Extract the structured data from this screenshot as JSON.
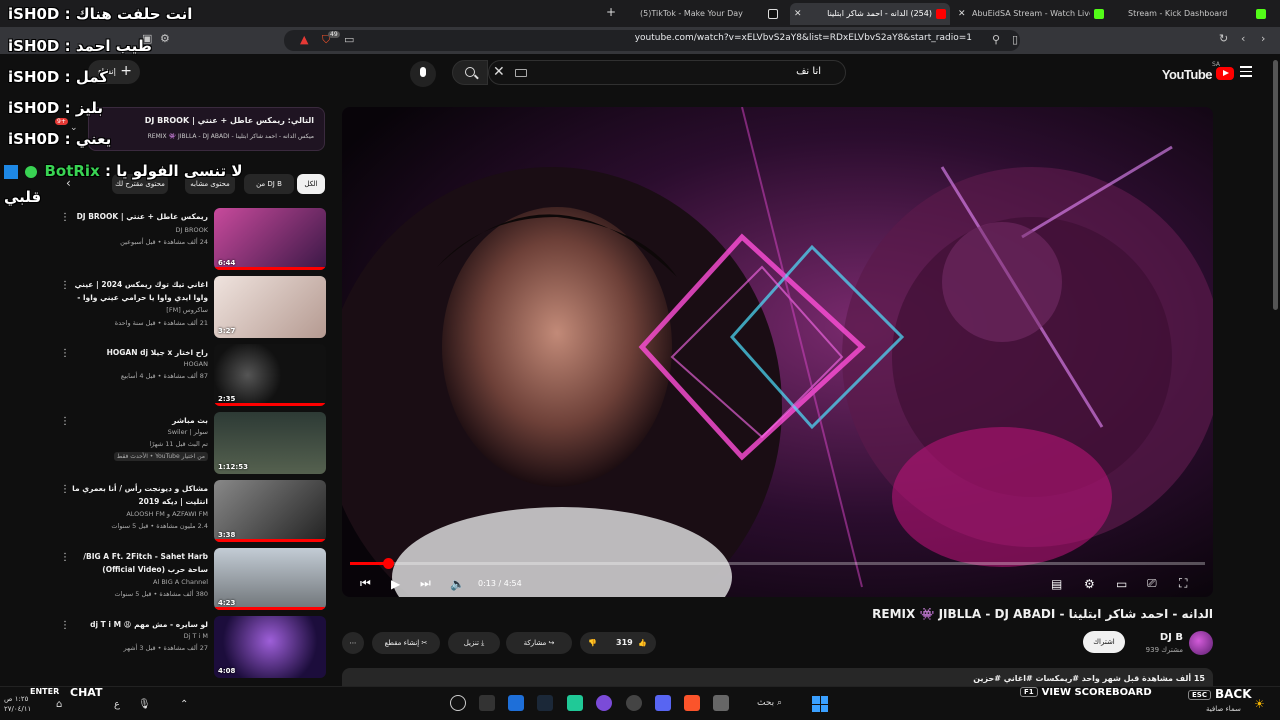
{
  "browser": {
    "tabs": [
      {
        "label": "Stream - Kick Dashboard",
        "active": false,
        "favicon_color": "#53fc18"
      },
      {
        "label": "AbuEidSA Stream - Watch Live o",
        "active": false,
        "favicon_color": "#53fc18"
      },
      {
        "label": "(254) الدانه - احمد شاكر ابتلينا",
        "active": true,
        "favicon_color": "#ff0000"
      },
      {
        "label": "(5)TikTok - Make Your Day",
        "active": false,
        "favicon_color": "#ffffff"
      }
    ],
    "url": "youtube.com/watch?v=xELVbvS2aY8&list=RDxELVbvS2aY8&start_radio=1",
    "badge_count": "49"
  },
  "youtube": {
    "logo_text": "YouTube",
    "region": "SA",
    "search_query": "انا نف",
    "create_label": "إنشاء",
    "notif_count": "9+",
    "video": {
      "current_time": "0:13",
      "duration": "4:54",
      "progress": 0.0442,
      "title": "الدانه - احمد شاكر ابتلينا - REMIX 👾 JIBLLA - DJ ABADI",
      "channel": "DJ B",
      "subscribers": "939 مشترك",
      "subscribe_label": "اشتراك",
      "likes": "319",
      "share_label": "مشاركة",
      "download_label": "تنزيل",
      "clip_label": "إنشاء مقطع",
      "views_line": "15 ألف مشاهدة قبل شهر واحد  #ريمكسات #اغاني #حزين"
    },
    "mix": {
      "title": "التالي: ريمكس عاطل + عنتي | DJ BROOK",
      "subtitle": "ميكس الدانه - احمد شاكر ابتلينا - REMIX 👾 JIBLLA - DJ ABADI"
    },
    "chips": [
      "الكل",
      "من DJ B",
      "محتوى مشابه",
      "محتوى مقترح لك"
    ],
    "related": [
      {
        "title": "ريمكس عاطل + عنتي | DJ BROOK",
        "channel": "DJ BROOK",
        "meta": "24 ألف مشاهدة • قبل أسبوعين",
        "duration": "6:44",
        "thumb": "#7a2d7d"
      },
      {
        "title": "اغاني تيك توك ريمكس 2024 | عيني واوا ايدي واوا يا حرامي عيني واوا - عرب أغنية ...",
        "channel": "ساكروس [FM]",
        "meta": "21 ألف مشاهدة • قبل سنة واحدة",
        "duration": "3:27",
        "thumb": "#d8c6c2"
      },
      {
        "title": "راح اختار x جيلا HOGAN dj",
        "channel": "HOGAN",
        "meta": "87 ألف مشاهدة • قبل 4 أسابيع",
        "duration": "2:35",
        "thumb": "#2a2a2a"
      },
      {
        "title": "بث مباشر",
        "channel": "سولر | Swiler",
        "meta": "تم البث قبل 11 شهرًا",
        "badge": "من اختيار YouTube • الأحدث فقط",
        "duration": "1:12:53",
        "thumb": "#3a4a42"
      },
      {
        "title": "مشاكل و ديونجت رأس / أنا بعمري ما انتليت | ديكه 2019",
        "channel": "AZFAWI FM و ALOOSH FM",
        "meta": "2.4 مليون مشاهدة • قبل 5 سنوات",
        "duration": "3:38",
        "thumb": "#555555"
      },
      {
        "title": "BIG A Ft. 2Fitch - Sahet Harb/ ساحة حرب (Official Video)",
        "channel": "Al BIG A Channel",
        "meta": "380 ألف مشاهدة • قبل 5 سنوات",
        "duration": "4:23",
        "thumb": "#9aa4ae"
      },
      {
        "title": "لو سايره - مش مهم 😩 dj T i M",
        "channel": "Dj T i M",
        "meta": "27 ألف مشاهدة • قبل 3 أشهر",
        "duration": "4:08",
        "thumb": "#3b1f6a"
      }
    ]
  },
  "overlay": {
    "lines": [
      {
        "user": "iSH0D",
        "msg": "انت حلفت هناك"
      },
      {
        "user": "iSH0D",
        "msg": "طيب احمد"
      },
      {
        "user": "iSH0D",
        "msg": "كمل"
      },
      {
        "user": "iSH0D",
        "msg": "بليز"
      },
      {
        "user": "iSH0D",
        "msg": "يعني"
      }
    ],
    "bot_user": "BotRix",
    "bot_msg": "لا تنسى الفولو يا",
    "bot_msg2": "قلبي"
  },
  "taskbar": {
    "enter_label": "ENTER",
    "chat_label": "CHAT",
    "f1_label": "F1",
    "scoreboard_label": "VIEW SCOREBOARD",
    "esc_label": "ESC",
    "back_label": "BACK",
    "search_label": "بحث",
    "time": "١:٢٥ ص",
    "date": "٢٧/٠٤/١١",
    "weather": "سماء صافية"
  }
}
